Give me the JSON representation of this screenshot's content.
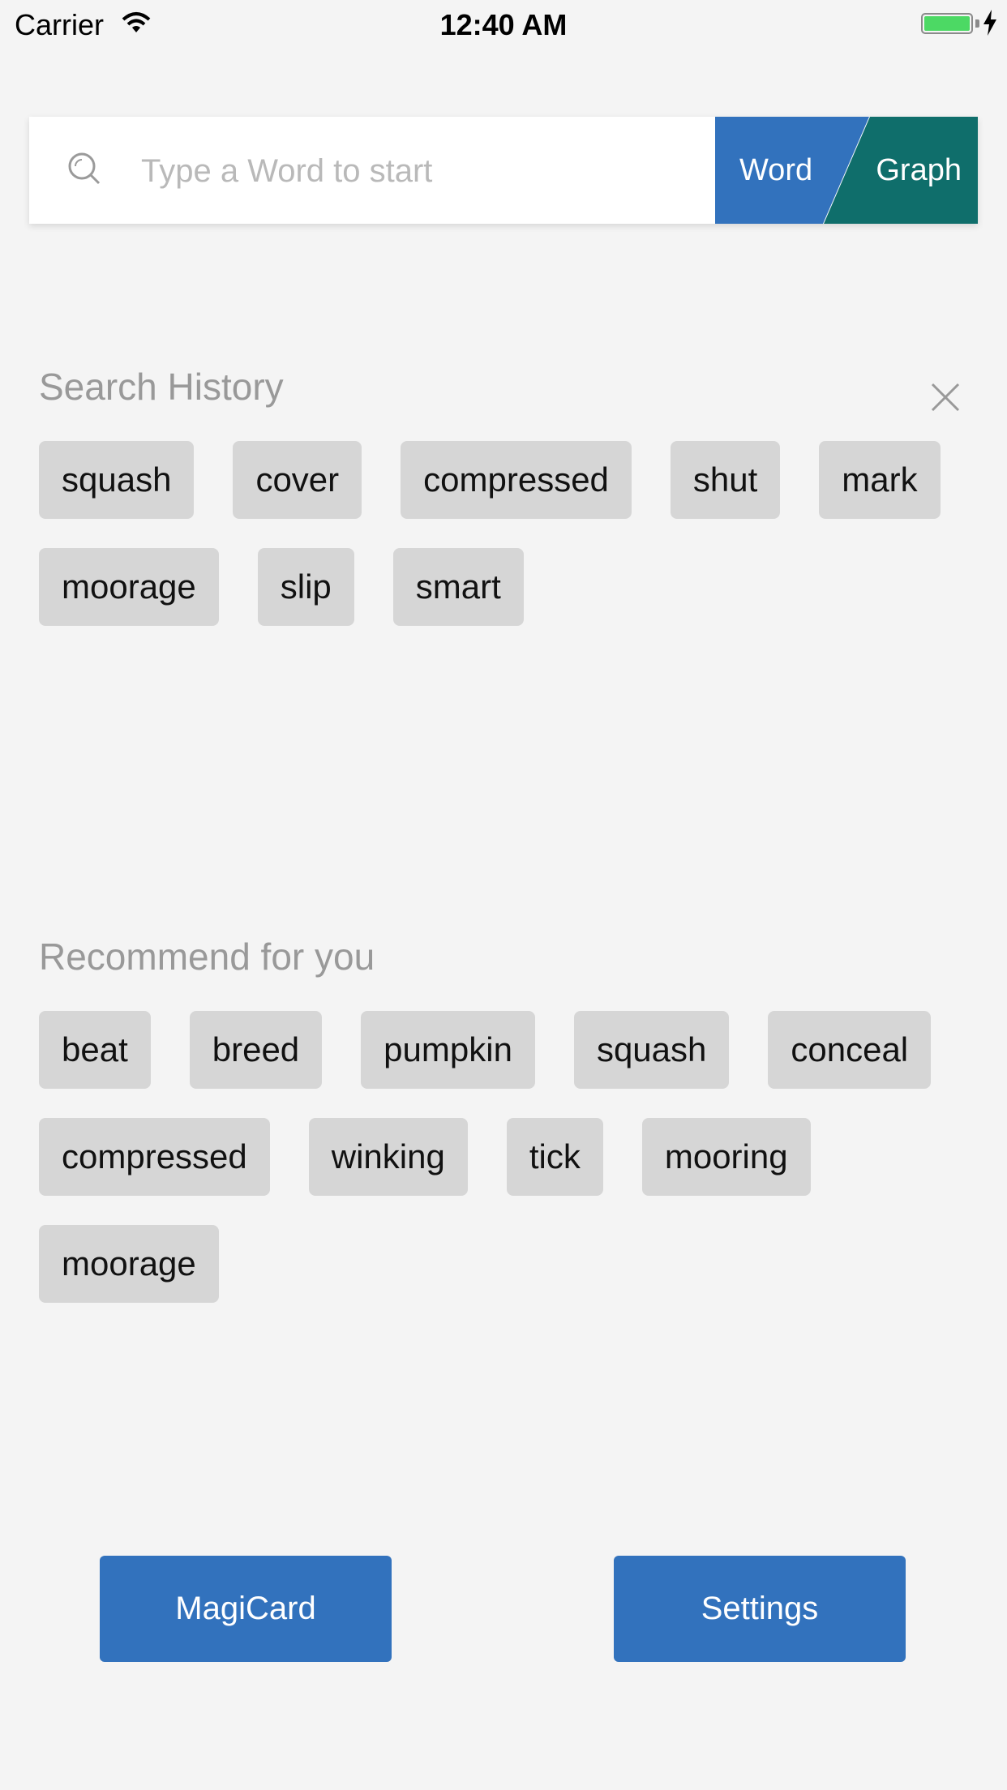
{
  "status_bar": {
    "carrier": "Carrier",
    "time": "12:40 AM",
    "wifi_icon": "wifi-icon",
    "battery_icon": "battery-icon",
    "battery_level": 1.0,
    "charging_icon": "charging-bolt-icon"
  },
  "search": {
    "placeholder": "Type a Word to start",
    "value": "",
    "icon": "search-icon",
    "mode_word_label": "Word",
    "mode_graph_label": "Graph"
  },
  "history": {
    "title": "Search History",
    "clear_icon": "close-icon",
    "rows": [
      [
        "squash",
        "cover",
        "compressed",
        "shut",
        "mark"
      ],
      [
        "moorage",
        "slip",
        "smart"
      ]
    ]
  },
  "recommend": {
    "title": "Recommend for you",
    "rows": [
      [
        "beat",
        "breed",
        "pumpkin",
        "squash",
        "conceal"
      ],
      [
        "compressed",
        "winking",
        "tick",
        "mooring"
      ],
      [
        "moorage"
      ]
    ]
  },
  "actions": {
    "magicard_label": "MagiCard",
    "settings_label": "Settings"
  },
  "colors": {
    "accent_blue": "#3272bd",
    "graph_teal": "#0f6e6b",
    "chip_bg": "#d6d6d6",
    "background": "#f4f4f4"
  }
}
